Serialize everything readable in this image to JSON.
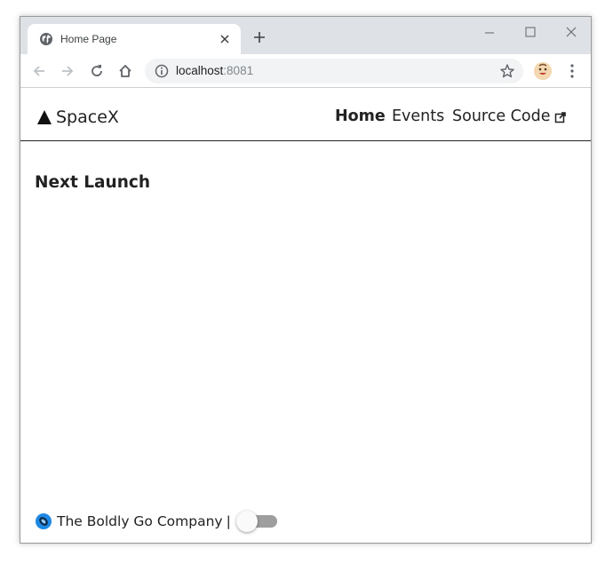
{
  "browser": {
    "tab_title": "Home Page",
    "url_host": "localhost",
    "url_port": ":8081",
    "icons": [
      "globe-icon",
      "close-icon",
      "new-tab-icon",
      "minimize-icon",
      "maximize-icon",
      "window-close-icon",
      "back-icon",
      "forward-icon",
      "reload-icon",
      "home-icon",
      "info-icon",
      "star-icon",
      "extension-avatar-icon",
      "menu-icon"
    ]
  },
  "navbar": {
    "brand": "SpaceX",
    "links": {
      "home": "Home",
      "events": "Events",
      "source": "Source Code"
    }
  },
  "main": {
    "heading": "Next Launch"
  },
  "footer": {
    "company": "The Boldly Go Company",
    "separator": "|",
    "toggle_on": false
  },
  "colors": {
    "text": "#222222",
    "tabstrip": "#dee1e6",
    "omnibox": "#f1f3f4",
    "toggle_track": "#9e9e9e"
  }
}
